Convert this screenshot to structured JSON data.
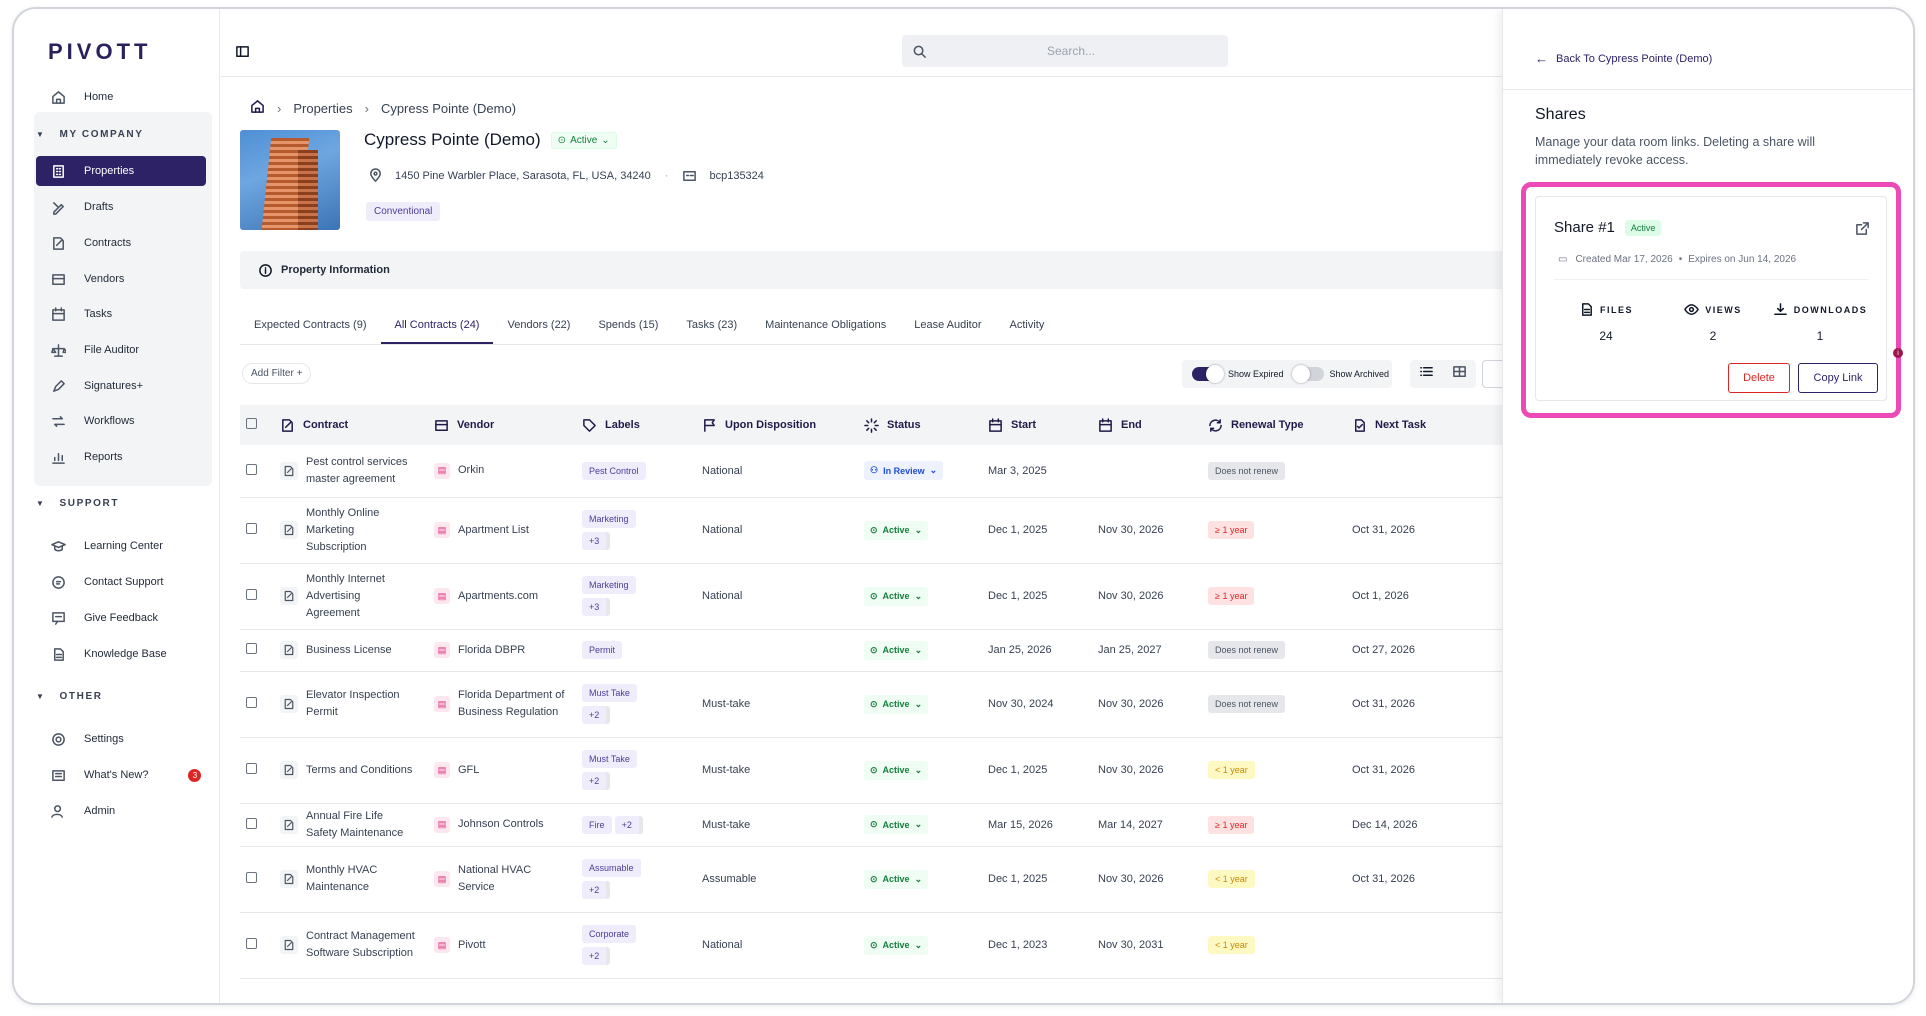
{
  "app": {
    "logo": "PIVOTT"
  },
  "sidebar": {
    "home": "Home",
    "sections": {
      "company": "MY COMPANY",
      "support": "SUPPORT",
      "other": "OTHER"
    },
    "company_items": [
      "Properties",
      "Drafts",
      "Contracts",
      "Vendors",
      "Tasks",
      "File Auditor",
      "Signatures+",
      "Workflows",
      "Reports"
    ],
    "support_items": [
      "Learning Center",
      "Contact Support",
      "Give Feedback",
      "Knowledge Base"
    ],
    "other_items": [
      "Settings",
      "What's New?",
      "Admin"
    ],
    "whats_new_badge": "3"
  },
  "search": {
    "placeholder": "Search..."
  },
  "breadcrumb": {
    "section": "Properties",
    "current": "Cypress Pointe (Demo)"
  },
  "property": {
    "name": "Cypress Pointe (Demo)",
    "status": "Active",
    "address": "1450 Pine Warbler Place, Sarasota, FL, USA, 34240",
    "code": "bcp135324",
    "tag": "Conventional",
    "info_label": "Property Information"
  },
  "tabs": [
    "Expected Contracts (9)",
    "All Contracts (24)",
    "Vendors (22)",
    "Spends (15)",
    "Tasks (23)",
    "Maintenance Obligations",
    "Lease Auditor",
    "Activity"
  ],
  "filters": {
    "add_filter": "Add Filter +",
    "show_expired": "Show Expired",
    "show_archived": "Show Archived"
  },
  "table": {
    "headers": [
      "Contract",
      "Vendor",
      "Labels",
      "Upon Disposition",
      "Status",
      "Start",
      "End",
      "Renewal Type",
      "Next Task"
    ],
    "rows": [
      {
        "contract": "Pest control services master agreement",
        "vendor": "Orkin",
        "label": "Pest Control",
        "more": "",
        "disposition": "National",
        "status": "In Review",
        "start": "Mar 3, 2025",
        "end": "",
        "renewal": "Does not renew",
        "next": ""
      },
      {
        "contract": "Monthly Online Marketing Subscription",
        "vendor": "Apartment List",
        "label": "Marketing",
        "more": "+3",
        "disposition": "National",
        "status": "Active",
        "start": "Dec 1, 2025",
        "end": "Nov 30, 2026",
        "renewal": "≥ 1 year",
        "next": "Oct 31, 2026"
      },
      {
        "contract": "Monthly Internet Advertising Agreement",
        "vendor": "Apartments.com",
        "label": "Marketing",
        "more": "+3",
        "disposition": "National",
        "status": "Active",
        "start": "Dec 1, 2025",
        "end": "Nov 30, 2026",
        "renewal": "≥ 1 year",
        "next": "Oct 1, 2026"
      },
      {
        "contract": "Business License",
        "vendor": "Florida DBPR",
        "label": "Permit",
        "more": "",
        "disposition": "",
        "status": "Active",
        "start": "Jan 25, 2026",
        "end": "Jan 25, 2027",
        "renewal": "Does not renew",
        "next": "Oct 27, 2026"
      },
      {
        "contract": "Elevator Inspection Permit",
        "vendor": "Florida Department of Business Regulation",
        "label": "Must Take",
        "more": "+2",
        "disposition": "Must-take",
        "status": "Active",
        "start": "Nov 30, 2024",
        "end": "Nov 30, 2026",
        "renewal": "Does not renew",
        "next": "Oct 31, 2026"
      },
      {
        "contract": "Terms and Conditions",
        "vendor": "GFL",
        "label": "Must Take",
        "more": "+2",
        "disposition": "Must-take",
        "status": "Active",
        "start": "Dec 1, 2025",
        "end": "Nov 30, 2026",
        "renewal": "< 1 year",
        "next": "Oct 31, 2026"
      },
      {
        "contract": "Annual Fire Life Safety Maintenance",
        "vendor": "Johnson Controls",
        "label": "Fire",
        "more": "+2",
        "disposition": "Must-take",
        "status": "Active",
        "start": "Mar 15, 2026",
        "end": "Mar 14, 2027",
        "renewal": "≥ 1 year",
        "next": "Dec 14, 2026"
      },
      {
        "contract": "Monthly HVAC Maintenance",
        "vendor": "National HVAC Service",
        "label": "Assumable",
        "more": "+2",
        "disposition": "Assumable",
        "status": "Active",
        "start": "Dec 1, 2025",
        "end": "Nov 30, 2026",
        "renewal": "< 1 year",
        "next": "Oct 31, 2026"
      },
      {
        "contract": "Contract Management Software Subscription",
        "vendor": "Pivott",
        "label": "Corporate",
        "more": "+2",
        "disposition": "National",
        "status": "Active",
        "start": "Dec 1, 2023",
        "end": "Nov 30, 2031",
        "renewal": "< 1 year",
        "next": ""
      }
    ]
  },
  "panel": {
    "back": "Back To Cypress Pointe (Demo)",
    "title": "Shares",
    "description": "Manage your data room links. Deleting a share will immediately revoke access.",
    "share": {
      "name": "Share #1",
      "status": "Active",
      "created": "Created Mar 17, 2026",
      "expires": "Expires on Jun 14, 2026",
      "files_label": "FILES",
      "files": "24",
      "views_label": "VIEWS",
      "views": "2",
      "downloads_label": "DOWNLOADS",
      "downloads": "1",
      "delete": "Delete",
      "copy": "Copy Link"
    },
    "dot_badge": "i"
  },
  "colors": {
    "brand": "#2e2266",
    "highlight": "#ec4ab7",
    "active_green": "#15803d",
    "danger": "#dc2626"
  }
}
